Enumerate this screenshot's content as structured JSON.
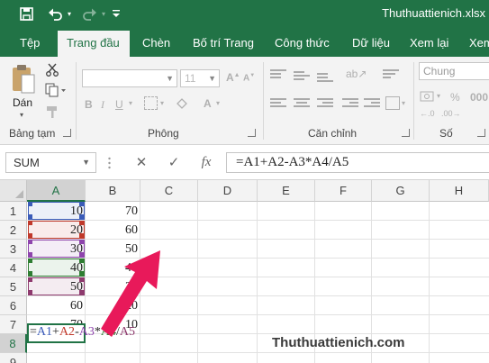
{
  "window": {
    "filename": "Thuthuattienich.xlsx",
    "icons": [
      "save-icon",
      "undo-icon",
      "redo-icon",
      "customize-qat-icon"
    ],
    "accent_color": "#217346"
  },
  "tabs": [
    {
      "label": "Tệp",
      "active": false
    },
    {
      "label": "Trang đầu",
      "active": true
    },
    {
      "label": "Chèn",
      "active": false
    },
    {
      "label": "Bố trí Trang",
      "active": false
    },
    {
      "label": "Công thức",
      "active": false
    },
    {
      "label": "Dữ liệu",
      "active": false
    },
    {
      "label": "Xem lại",
      "active": false
    },
    {
      "label": "Xem nh",
      "active": false
    }
  ],
  "ribbon": {
    "clipboard": {
      "paste_label": "Dán",
      "group_label": "Bảng tạm",
      "icons": [
        "paste-icon",
        "cut-icon",
        "copy-icon",
        "format-painter-icon"
      ]
    },
    "font": {
      "group_label": "Phông",
      "font_name": "",
      "font_size": "11"
    },
    "alignment": {
      "group_label": "Căn chỉnh"
    },
    "number": {
      "group_label": "Số",
      "format": "Chung"
    }
  },
  "formula_bar": {
    "name_box": "SUM",
    "cancel_symbol": "✕",
    "enter_symbol": "✓",
    "fx_symbol": "fx",
    "formula": "=A1+A2-A3*A4/A5"
  },
  "sheet": {
    "columns": [
      "A",
      "B",
      "C",
      "D",
      "E",
      "F",
      "G",
      "H"
    ],
    "rows": [
      "1",
      "2",
      "3",
      "4",
      "5",
      "6",
      "7",
      "8",
      "9"
    ],
    "selected_column": "A",
    "selected_row": "8",
    "col_a": [
      "10",
      "20",
      "30",
      "40",
      "50",
      "60",
      "70"
    ],
    "col_b": [
      "70",
      "60",
      "50",
      "40",
      "30",
      "20",
      "10"
    ],
    "edit_tokens": [
      {
        "text": "=",
        "color": "#222222"
      },
      {
        "text": "A1",
        "color": "#3a5bb8"
      },
      {
        "text": "+",
        "color": "#222222"
      },
      {
        "text": "A2",
        "color": "#c0392b"
      },
      {
        "text": "-",
        "color": "#222222"
      },
      {
        "text": "A3",
        "color": "#8e44ad"
      },
      {
        "text": "*",
        "color": "#222222"
      },
      {
        "text": "A4",
        "color": "#2e7d32"
      },
      {
        "text": "/",
        "color": "#222222"
      },
      {
        "text": "A5",
        "color": "#8e3a6e"
      }
    ],
    "ref_colors": [
      "#3a5bb8",
      "#c0392b",
      "#8e44ad",
      "#2e7d32",
      "#8e3a6e"
    ]
  },
  "overlay": {
    "watermark": "Thuthuattienich.com",
    "arrow_color": "#e8195a"
  }
}
